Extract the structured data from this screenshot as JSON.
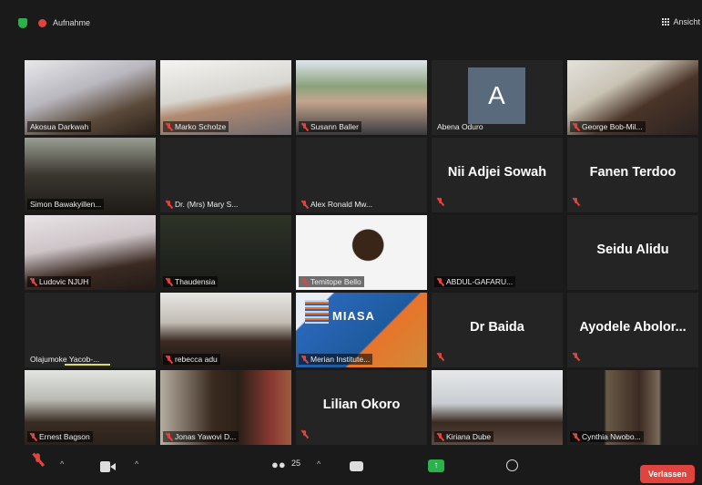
{
  "topbar": {
    "recording_label": "Aufnahme",
    "view_label": "Ansicht"
  },
  "tiles": [
    {
      "name": "Akosua Darkwah"
    },
    {
      "name": "Marko Scholze"
    },
    {
      "name": "Susann Baller"
    },
    {
      "name": "Abena Oduro",
      "initial": "A"
    },
    {
      "name": "George Bob-Mil..."
    },
    {
      "name": "Simon Bawakyillen..."
    },
    {
      "name": "Dr. (Mrs) Mary S..."
    },
    {
      "name": "Alex Ronald Mw..."
    },
    {
      "name": "Nii Adjei Sowah"
    },
    {
      "name": "Fanen Terdoo"
    },
    {
      "name": "Ludovic NJUH"
    },
    {
      "name": "Thaudensia"
    },
    {
      "name": "Temitope Bello"
    },
    {
      "name": "ABDUL-GAFARU..."
    },
    {
      "name": "Seidu Alidu"
    },
    {
      "name": "Olajumoke Yacob-..."
    },
    {
      "name": "rebecca adu"
    },
    {
      "name": "Merian Institute...",
      "logo_text": "MIASA"
    },
    {
      "name": "Dr Baida"
    },
    {
      "name": "Ayodele Abolor..."
    },
    {
      "name": "Ernest Bagson"
    },
    {
      "name": "Jonas Yawovi D..."
    },
    {
      "name": "Lilian Okoro"
    },
    {
      "name": "Kiriana Dube"
    },
    {
      "name": "Cynthia Nwobo..."
    }
  ],
  "toolbar": {
    "participant_count": "25",
    "leave_label": "Verlassen"
  },
  "colors": {
    "speaker_highlight": "#dadb6a",
    "muted_red": "#e0443e",
    "share_green": "#2bb24c"
  }
}
